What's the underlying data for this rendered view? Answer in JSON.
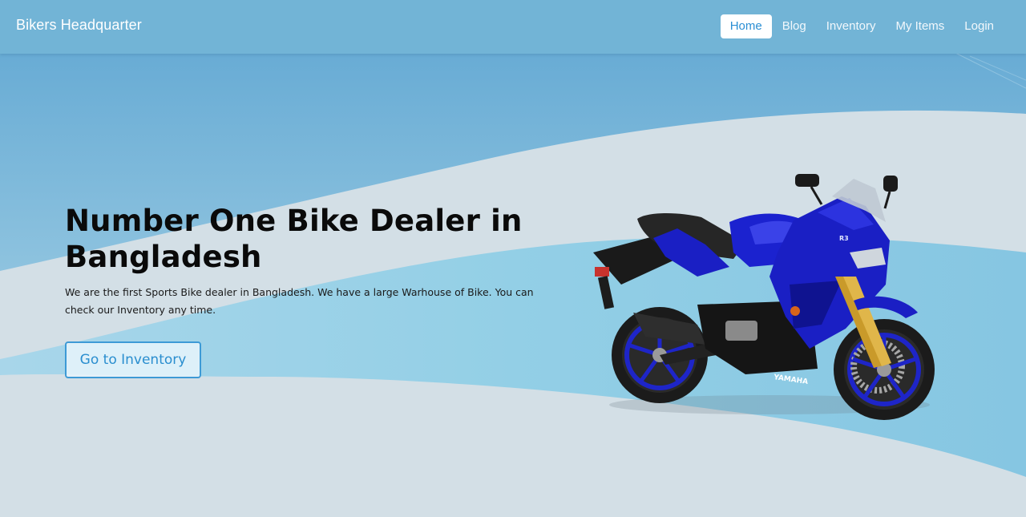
{
  "navbar": {
    "brand": "Bikers Headquarter",
    "links": [
      {
        "label": "Home",
        "active": true
      },
      {
        "label": "Blog",
        "active": false
      },
      {
        "label": "Inventory",
        "active": false
      },
      {
        "label": "My Items",
        "active": false
      },
      {
        "label": "Login",
        "active": false
      }
    ]
  },
  "hero": {
    "title": "Number One Bike Dealer in Bangladesh",
    "description": "We are the first Sports Bike dealer in Bangladesh. We have a large Warhouse of Bike. You can check our Inventory any time.",
    "cta_label": "Go to Inventory",
    "bike_badge": "YAMAHA",
    "bike_model": "R3"
  },
  "colors": {
    "navbar_bg": "#72b4d6",
    "sky_blue": "#69aed6",
    "wave_light": "#d3dfe6",
    "wave_blue": "#92cfe6",
    "accent": "#2b8fd4",
    "bike_blue": "#1a1fc4"
  },
  "icons": {
    "hero_image": "motorcycle-image"
  }
}
